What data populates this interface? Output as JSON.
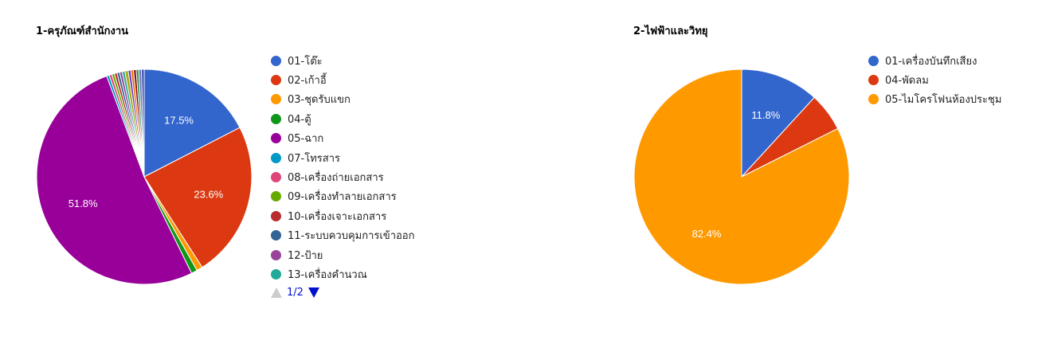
{
  "chart_data": [
    {
      "type": "pie",
      "title": "1-ครุภัณฑ์สำนักงาน",
      "slices": [
        {
          "label": "01-โต๊ะ",
          "value": 17.5,
          "color": "#3366cc",
          "data_label": "17.5%"
        },
        {
          "label": "02-เก้าอี้",
          "value": 23.6,
          "color": "#dc3912",
          "data_label": "23.6%"
        },
        {
          "label": "03-ชุดรับแขก",
          "value": 0.9,
          "color": "#ff9900",
          "data_label": ""
        },
        {
          "label": "04-ตู้",
          "value": 0.9,
          "color": "#109618",
          "data_label": ""
        },
        {
          "label": "05-ฉาก",
          "value": 51.8,
          "color": "#990099",
          "data_label": "51.8%"
        },
        {
          "label": "07-โทรสาร",
          "value": 0.4,
          "color": "#0099c6",
          "data_label": ""
        },
        {
          "label": "08-เครื่องถ่ายเอกสาร",
          "value": 0.4,
          "color": "#dd4477",
          "data_label": ""
        },
        {
          "label": "09-เครื่องทำลายเอกสาร",
          "value": 0.4,
          "color": "#66aa00",
          "data_label": ""
        },
        {
          "label": "10-เครื่องเจาะเอกสาร",
          "value": 0.4,
          "color": "#b82e2e",
          "data_label": ""
        },
        {
          "label": "11-ระบบควบคุมการเข้าออก",
          "value": 0.4,
          "color": "#316395",
          "data_label": ""
        },
        {
          "label": "12-ป้าย",
          "value": 0.4,
          "color": "#994499",
          "data_label": ""
        },
        {
          "label": "13-เครื่องคำนวณ",
          "value": 0.4,
          "color": "#22aa99",
          "data_label": ""
        },
        {
          "label": "",
          "value": 0.5,
          "color": "#aaaa11",
          "data_label": "",
          "in_legend": false
        },
        {
          "label": "",
          "value": 0.4,
          "color": "#6633cc",
          "data_label": "",
          "in_legend": false
        },
        {
          "label": "",
          "value": 0.4,
          "color": "#e67300",
          "data_label": "",
          "in_legend": false
        },
        {
          "label": "",
          "value": 0.4,
          "color": "#8b0707",
          "data_label": "",
          "in_legend": false
        },
        {
          "label": "",
          "value": 0.4,
          "color": "#329262",
          "data_label": "",
          "in_legend": false
        },
        {
          "label": "",
          "value": 0.4,
          "color": "#5574a6",
          "data_label": "",
          "in_legend": false
        },
        {
          "label": "",
          "value": 0.4,
          "color": "#3b3eac",
          "data_label": "",
          "in_legend": false
        }
      ],
      "legend_position": "right",
      "pager": {
        "text": "1/2"
      }
    },
    {
      "type": "pie",
      "title": "2-ไฟฟ้าและวิทยุ",
      "slices": [
        {
          "label": "01-เครื่องบันทึกเสียง",
          "value": 11.8,
          "color": "#3366cc",
          "data_label": "11.8%"
        },
        {
          "label": "04-พัดลม",
          "value": 5.8,
          "color": "#dc3912",
          "data_label": ""
        },
        {
          "label": "05-ไมโครโฟนห้องประชุม",
          "value": 82.4,
          "color": "#ff9900",
          "data_label": "82.4%"
        }
      ],
      "legend_position": "right"
    }
  ]
}
